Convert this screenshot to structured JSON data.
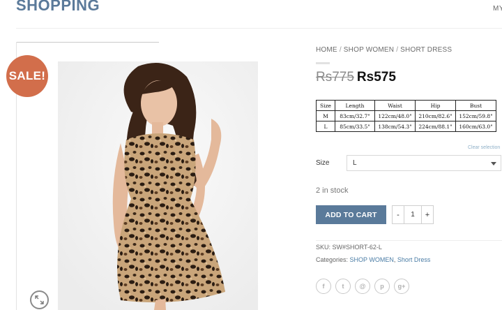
{
  "header": {
    "logo": "SHOPPING",
    "my_account": "MY"
  },
  "product": {
    "sale_badge": "SALE!",
    "breadcrumb": [
      "HOME",
      "SHOP WOMEN",
      "SHORT DRESS"
    ],
    "breadcrumb_sep": "/",
    "old_price": "Rs775",
    "new_price": "Rs575",
    "size_chart": {
      "headers": [
        "Size",
        "Length",
        "Waist",
        "Hip",
        "Bust"
      ],
      "rows": [
        [
          "M",
          "83cm/32.7\"",
          "122cm/48.0\"",
          "210cm/82.6\"",
          "152cm/59.8\""
        ],
        [
          "L",
          "85cm/33.5\"",
          "138cm/54.3\"",
          "224cm/88.1\"",
          "160cm/63.0\""
        ]
      ]
    },
    "clear_selection": "Clear selection",
    "size_label": "Size",
    "size_selected": "L",
    "stock": "2 in stock",
    "add_to_cart": "ADD TO CART",
    "qty_minus": "-",
    "qty_value": "1",
    "qty_plus": "+",
    "sku_label": "SKU:",
    "sku_value": "SW#SHORT-62-L",
    "categories_label": "Categories:",
    "categories": [
      "SHOP WOMEN",
      "Short Dress"
    ],
    "share_icons": [
      "facebook-icon",
      "twitter-icon",
      "email-icon",
      "pinterest-icon",
      "google-plus-icon"
    ],
    "share_glyphs": [
      "f",
      "t",
      "@",
      "p",
      "g+"
    ]
  },
  "colors": {
    "brand": "#5b7a9a",
    "sale": "#d26e4b",
    "link": "#4a7ca5"
  }
}
